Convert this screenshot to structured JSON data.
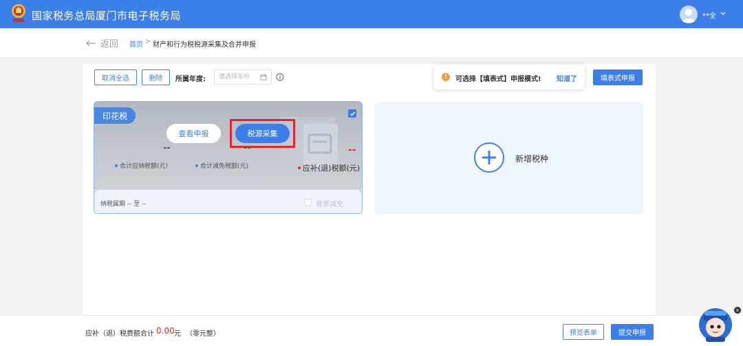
{
  "header": {
    "title": "国家税务总局厦门市电子税务局",
    "user_name": "**全",
    "brand_color": "#3d7fe8"
  },
  "breadcrumb": {
    "back_label": "返回",
    "home": "首页",
    "separator": ">",
    "current": "财产和行为税税源采集及合并申报"
  },
  "toolbar": {
    "deselect_all": "取消全选",
    "delete": "删除",
    "year_label": "所属年度:",
    "year_placeholder": "请选择年份",
    "form_declare": "填表式申报"
  },
  "tooltip": {
    "text": "可选择【填表式】申报模式!",
    "link": "知道了",
    "icon_text": "!"
  },
  "tax_card": {
    "tag": "印花税",
    "checked": true,
    "view_button": "查看申报",
    "collect_button": "税源采集",
    "stats": [
      {
        "label": "合计应纳税额(元)",
        "value": "--"
      },
      {
        "label": "合计减免税额(元)",
        "value": "--"
      },
      {
        "label": "应补(退)税额(元)",
        "value": "--"
      }
    ],
    "period": "纳税属期 -- 至 --",
    "preference_label": "普惠减免",
    "preference_checked": false
  },
  "add_tax": {
    "label": "新增税种"
  },
  "footer": {
    "total_label": "应补（退）税费额合计",
    "total_value": "0.00",
    "unit": "元",
    "amount_words": "（零元整）",
    "preview_button": "预览表单",
    "submit_button": "提交申报"
  },
  "mascot": {
    "close_text": "x"
  }
}
